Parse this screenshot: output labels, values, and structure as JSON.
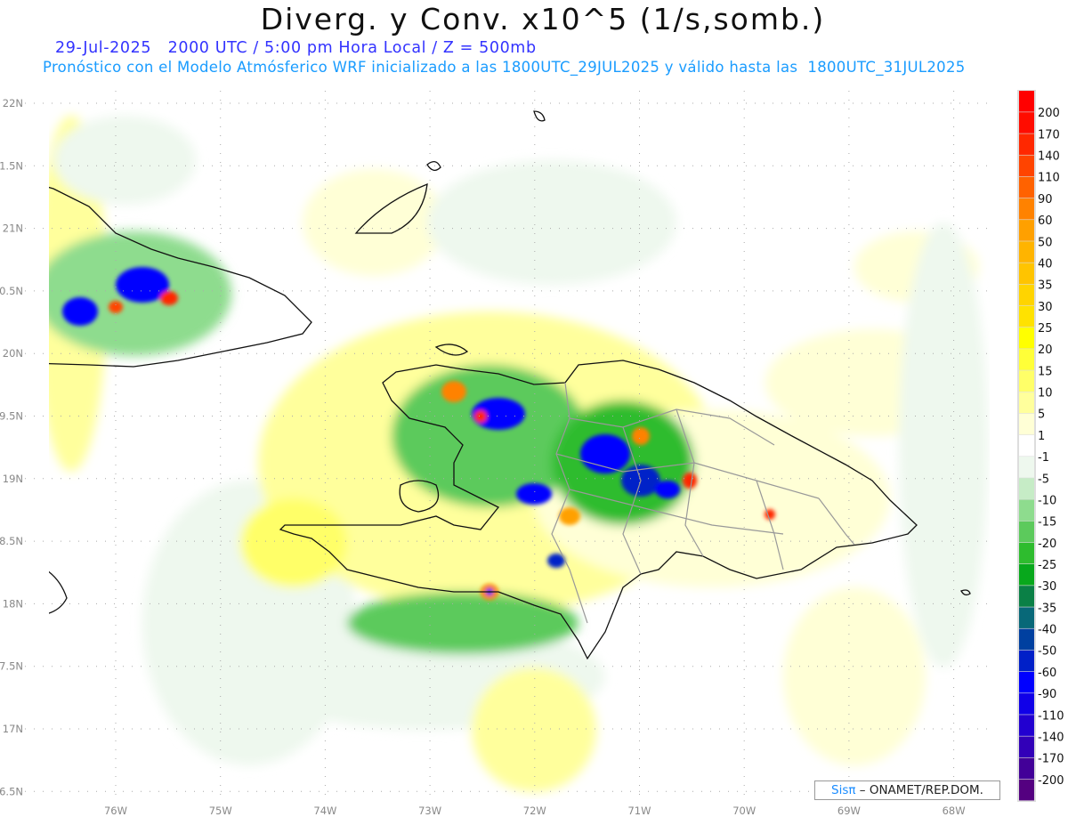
{
  "title": "Diverg. y Conv. x10^5 (1/s,somb.)",
  "subtitle_line1": "29-Jul-2025   2000 UTC / 5:00 pm Hora Local / Z = 500mb",
  "subtitle_line2": "Pronóstico con el Modelo Atmósferico WRF inicializado a las 1800UTC_29JUL2025 y válido hasta las  1800UTC_31JUL2025",
  "axes": {
    "lon_labels": [
      "76W",
      "75W",
      "74W",
      "73W",
      "72W",
      "71W",
      "70W",
      "69W",
      "68W"
    ],
    "lat_labels": [
      "22N",
      "1.5N",
      "21N",
      "0.5N",
      "20N",
      "9.5N",
      "19N",
      "8.5N",
      "18N",
      "7.5N",
      "17N",
      "6.5N"
    ]
  },
  "colorbar": {
    "labels": [
      "200",
      "170",
      "140",
      "110",
      "90",
      "60",
      "50",
      "40",
      "35",
      "30",
      "25",
      "20",
      "15",
      "10",
      "5",
      "1",
      "-1",
      "-5",
      "-10",
      "-15",
      "-20",
      "-25",
      "-30",
      "-35",
      "-40",
      "-50",
      "-60",
      "-90",
      "-110",
      "-140",
      "-170",
      "-200"
    ],
    "colors": [
      "#ff0000",
      "#ff0c00",
      "#ff2800",
      "#ff4400",
      "#ff6200",
      "#ff8200",
      "#ffa000",
      "#ffb400",
      "#ffc400",
      "#ffd400",
      "#ffe200",
      "#ffff00",
      "#ffff38",
      "#ffff68",
      "#ffff9c",
      "#ffffd6",
      "#ffffff",
      "#eef8ee",
      "#c6ecc6",
      "#8edc8e",
      "#5cca5c",
      "#2ebc2e",
      "#08a81c",
      "#0a8046",
      "#086878",
      "#0040a0",
      "#0020c8",
      "#0000ff",
      "#1000e8",
      "#2200d0",
      "#3200b8",
      "#420098",
      "#540080"
    ]
  },
  "credit": {
    "logo": "Sisπ",
    "text": " – ONAMET/REP.DOM."
  }
}
